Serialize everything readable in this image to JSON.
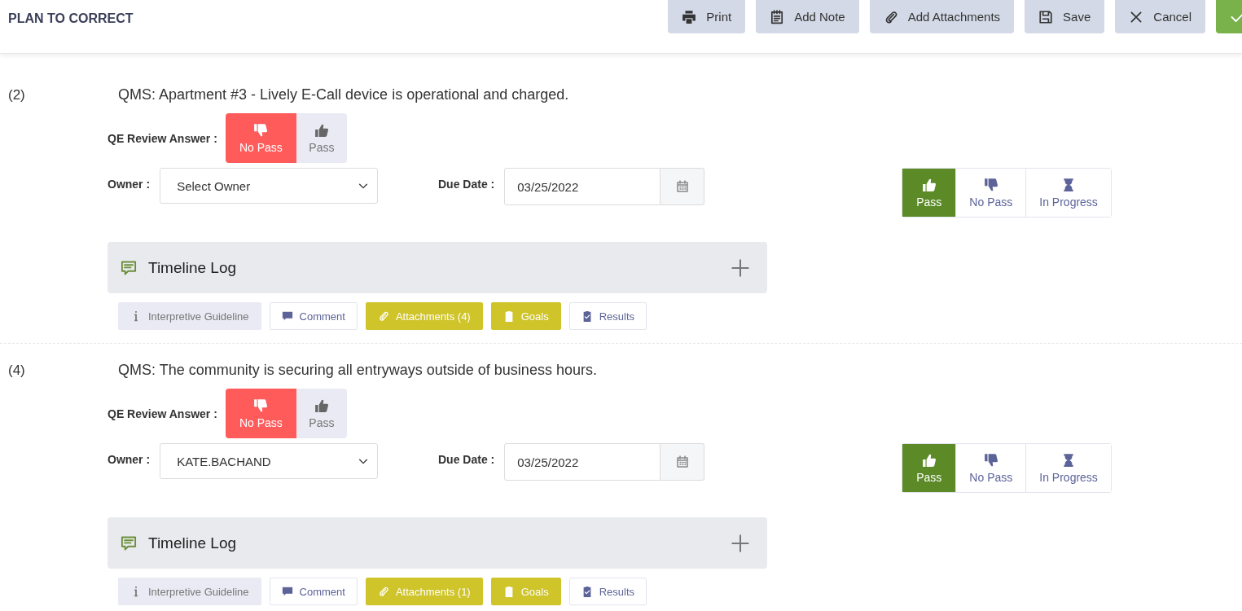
{
  "header": {
    "title": "PLAN TO CORRECT",
    "buttons": [
      {
        "label": "Print",
        "kind": "plain"
      },
      {
        "label": "Add Note",
        "kind": "plain"
      },
      {
        "label": "Add Attachments",
        "kind": "plain"
      },
      {
        "label": "Save",
        "kind": "plain"
      },
      {
        "label": "Cancel",
        "kind": "plain"
      },
      {
        "kind": "confirm"
      }
    ]
  },
  "items": [
    {
      "number": "(2)",
      "question": "QMS: Apartment #3 - Lively E-Call device is operational and charged.",
      "review_label": "QE Review Answer :",
      "review_options": [
        {
          "label": "No Pass",
          "kind": "fail",
          "selected": true
        },
        {
          "label": "Pass",
          "kind": "pass",
          "selected": false
        }
      ],
      "owner_label": "Owner :",
      "owner": {
        "placeholder": "Select Owner"
      },
      "due_label": "Due Date :",
      "due_date": "03/25/2022",
      "status_options": [
        {
          "label": "Pass",
          "kind": "pass",
          "selected": true
        },
        {
          "label": "No Pass",
          "kind": "fail",
          "selected": false
        },
        {
          "label": "In Progress",
          "kind": "pending",
          "selected": false
        }
      ],
      "timeline": "Timeline Log",
      "chips": [
        {
          "label": "Interpretive Guideline",
          "kind": "muted"
        },
        {
          "label": "Comment",
          "kind": "outline"
        },
        {
          "label": "Attachments (4)",
          "kind": "accent"
        },
        {
          "label": "Goals",
          "kind": "accent"
        },
        {
          "label": "Results",
          "kind": "outline"
        }
      ]
    },
    {
      "number": "(4)",
      "question": "QMS: The community is securing all entryways outside of business hours.",
      "review_label": "QE Review Answer :",
      "review_options": [
        {
          "label": "No Pass",
          "kind": "fail",
          "selected": true
        },
        {
          "label": "Pass",
          "kind": "pass",
          "selected": false
        }
      ],
      "owner_label": "Owner :",
      "owner": {
        "value": "KATE.BACHAND"
      },
      "due_label": "Due Date :",
      "due_date": "03/25/2022",
      "status_options": [
        {
          "label": "Pass",
          "kind": "pass",
          "selected": true
        },
        {
          "label": "No Pass",
          "kind": "fail",
          "selected": false
        },
        {
          "label": "In Progress",
          "kind": "pending",
          "selected": false
        }
      ],
      "timeline": "Timeline Log",
      "chips": [
        {
          "label": "Interpretive Guideline",
          "kind": "muted"
        },
        {
          "label": "Comment",
          "kind": "outline"
        },
        {
          "label": "Attachments (1)",
          "kind": "accent"
        },
        {
          "label": "Goals",
          "kind": "accent"
        },
        {
          "label": "Results",
          "kind": "outline"
        }
      ]
    }
  ]
}
